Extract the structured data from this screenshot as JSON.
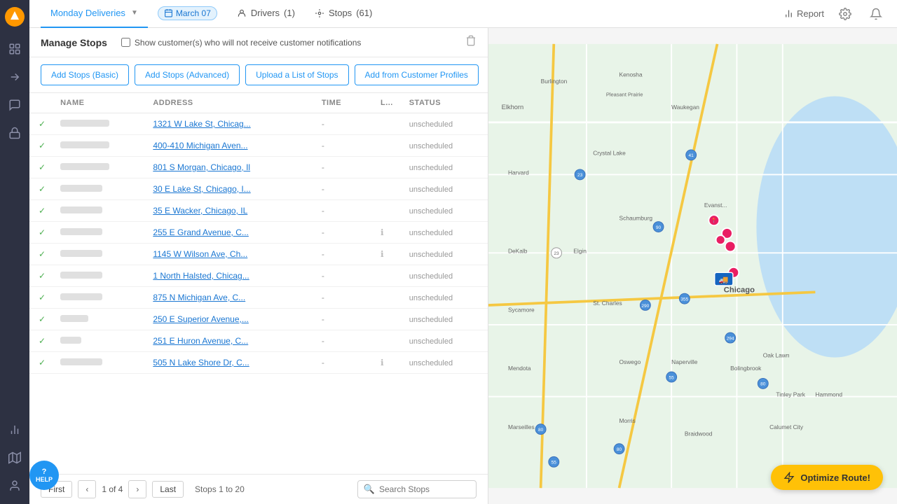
{
  "sidebar": {
    "logo": "🔶",
    "items": [
      {
        "id": "home",
        "icon": "⊞",
        "label": "Home",
        "active": false
      },
      {
        "id": "routes",
        "icon": "↗",
        "label": "Routes",
        "active": false
      },
      {
        "id": "messages",
        "icon": "✉",
        "label": "Messages",
        "active": false
      },
      {
        "id": "lock",
        "icon": "🔒",
        "label": "Lock",
        "active": false
      },
      {
        "id": "analytics",
        "icon": "📊",
        "label": "Analytics",
        "active": false
      },
      {
        "id": "map-pin",
        "icon": "📍",
        "label": "Map",
        "active": false
      },
      {
        "id": "person",
        "icon": "👤",
        "label": "Person",
        "active": false
      }
    ]
  },
  "topnav": {
    "route_name": "Monday Deliveries",
    "date_label": "March 07",
    "drivers_label": "Drivers",
    "drivers_count": "(1)",
    "stops_label": "Stops",
    "stops_count": "(61)",
    "report_label": "Report"
  },
  "manage_stops": {
    "title": "Manage Stops",
    "notification_label": "Show customer(s) who will not receive customer notifications",
    "add_basic_label": "Add Stops (Basic)",
    "add_advanced_label": "Add Stops (Advanced)",
    "upload_label": "Upload a List of Stops",
    "add_profile_label": "Add from Customer Profiles"
  },
  "table": {
    "headers": {
      "name": "NAME",
      "address": "ADDRESS",
      "time": "TIME",
      "load": "L...",
      "status": "STATUS"
    },
    "rows": [
      {
        "id": 1,
        "name_width": 70,
        "address": "1321 W Lake St, Chicag...",
        "time": "-",
        "load": "",
        "status": "unscheduled",
        "info": false
      },
      {
        "id": 2,
        "name_width": 70,
        "address": "400-410 Michigan Aven...",
        "time": "-",
        "load": "",
        "status": "unscheduled",
        "info": false
      },
      {
        "id": 3,
        "name_width": 70,
        "address": "801 S Morgan, Chicago, Il",
        "time": "-",
        "load": "",
        "status": "unscheduled",
        "info": false
      },
      {
        "id": 4,
        "name_width": 60,
        "address": "30 E Lake St, Chicago, I...",
        "time": "-",
        "load": "",
        "status": "unscheduled",
        "info": false
      },
      {
        "id": 5,
        "name_width": 60,
        "address": "35 E Wacker, Chicago, IL",
        "time": "-",
        "load": "",
        "status": "unscheduled",
        "info": false
      },
      {
        "id": 6,
        "name_width": 60,
        "address": "255 E Grand Avenue, C...",
        "time": "-",
        "load": "ℹ",
        "status": "unscheduled",
        "info": true
      },
      {
        "id": 7,
        "name_width": 60,
        "address": "1145 W Wilson Ave, Ch...",
        "time": "-",
        "load": "ℹ",
        "status": "unscheduled",
        "info": true
      },
      {
        "id": 8,
        "name_width": 60,
        "address": "1 North Halsted, Chicag...",
        "time": "-",
        "load": "",
        "status": "unscheduled",
        "info": false
      },
      {
        "id": 9,
        "name_width": 60,
        "address": "875 N Michigan Ave, C...",
        "time": "-",
        "load": "",
        "status": "unscheduled",
        "info": false
      },
      {
        "id": 10,
        "name_width": 40,
        "address": "250 E Superior Avenue,...",
        "time": "-",
        "load": "",
        "status": "unscheduled",
        "info": false
      },
      {
        "id": 11,
        "name_width": 30,
        "address": "251 E Huron Avenue, C...",
        "time": "-",
        "load": "",
        "status": "unscheduled",
        "info": false
      },
      {
        "id": 12,
        "name_width": 60,
        "address": "505 N Lake Shore Dr, C...",
        "time": "-",
        "load": "ℹ",
        "status": "unscheduled",
        "info": true
      }
    ]
  },
  "pagination": {
    "first_label": "First",
    "last_label": "Last",
    "page_info": "1 of 4",
    "stops_range": "Stops 1 to 20",
    "search_placeholder": "Search Stops"
  },
  "optimize": {
    "label": "Optimize Route!"
  },
  "help": {
    "label": "HELP"
  }
}
